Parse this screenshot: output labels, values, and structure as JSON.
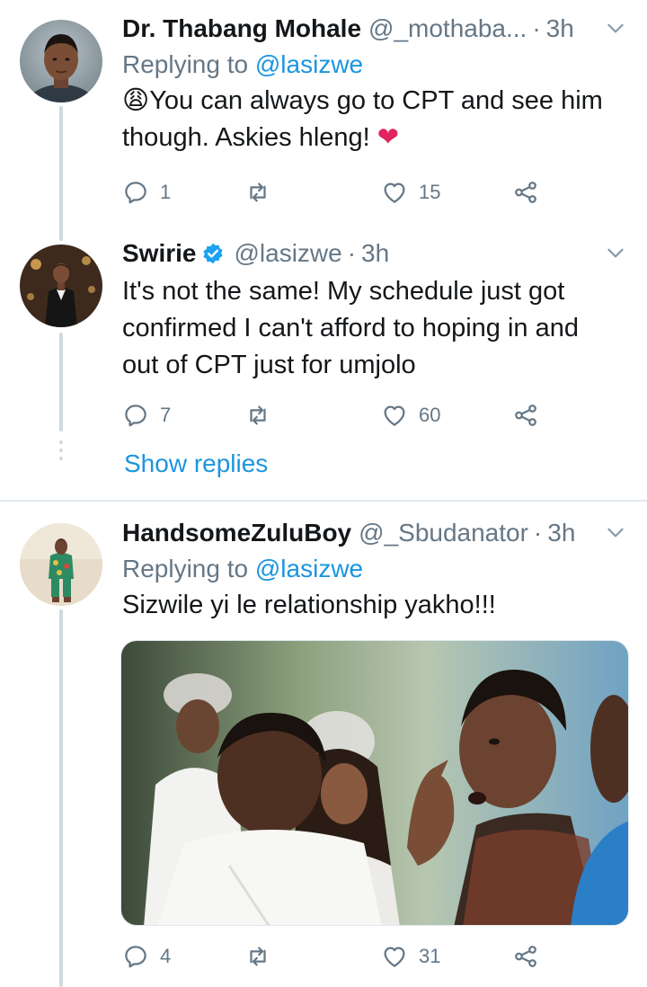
{
  "tweets": [
    {
      "name": "Dr. Thabang Mohale",
      "handle": "@_mothaba...",
      "time": "3h",
      "replying_prefix": "Replying to",
      "replying_mention": "@lasizwe",
      "emoji": "😩",
      "text_line1": "You can always go to CPT and see him",
      "text_line2": "though. Askies hleng!",
      "heart_emoji": "❤",
      "replies": "1",
      "retweets": "",
      "likes": "15"
    },
    {
      "name": "Swirie",
      "handle": "@lasizwe",
      "time": "3h",
      "verified": true,
      "text_line1": "It's not the same! My schedule just got",
      "text_line2": "confirmed I can't afford to hoping in and",
      "text_line3": "out of CPT just for umjolo",
      "replies": "7",
      "retweets": "",
      "likes": "60"
    },
    {
      "name": "HandsomeZuluBoy",
      "handle": "@_Sbudanator",
      "time": "3h",
      "replying_prefix": "Replying to",
      "replying_mention": "@lasizwe",
      "text_line1": "Sizwile yi le relationship yakho!!!",
      "replies": "4",
      "retweets": "",
      "likes": "31"
    }
  ],
  "show_replies": "Show replies",
  "dot_separator": "·",
  "colors": {
    "link": "#1b95e0",
    "secondary": "#657786",
    "heart": "#e0245e",
    "verified": "#1da1f2"
  },
  "icons": {
    "reply": "reply-icon",
    "retweet": "retweet-icon",
    "like": "like-icon",
    "share": "share-icon",
    "more": "chevron-down-icon",
    "verified": "verified-badge-icon"
  }
}
